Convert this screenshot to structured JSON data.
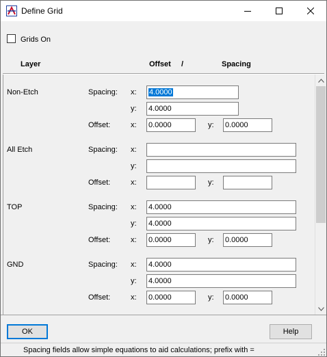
{
  "window": {
    "title": "Define Grid"
  },
  "grids_on": {
    "label": "Grids On",
    "checked": false
  },
  "headers": {
    "layer": "Layer",
    "offset": "Offset",
    "slash": "/",
    "spacing": "Spacing"
  },
  "labels": {
    "spacing": "Spacing:",
    "offset": "Offset:",
    "x": "x:",
    "y": "y:"
  },
  "layers": [
    {
      "name": "Non-Etch",
      "spacing_x": "4.0000",
      "spacing_y": "4.0000",
      "offset_x": "0.0000",
      "offset_y": "0.0000"
    },
    {
      "name": "All Etch",
      "spacing_x": "",
      "spacing_y": "",
      "offset_x": "",
      "offset_y": ""
    },
    {
      "name": "TOP",
      "spacing_x": "4.0000",
      "spacing_y": "4.0000",
      "offset_x": "0.0000",
      "offset_y": "0.0000"
    },
    {
      "name": "GND",
      "spacing_x": "4.0000",
      "spacing_y": "4.0000",
      "offset_x": "0.0000",
      "offset_y": "0.0000"
    }
  ],
  "buttons": {
    "ok": "OK",
    "help": "Help"
  },
  "status": "Spacing fields allow simple equations to aid calculations; prefix with =",
  "colors": {
    "selection": "#0078d7",
    "app_icon_red": "#c8102e",
    "app_icon_blue": "#1f3f9f"
  },
  "icons": {
    "app": "define-grid-app-icon",
    "minimize": "minimize-icon",
    "maximize": "maximize-icon",
    "close": "close-icon",
    "scroll_up": "scroll-up-arrow-icon",
    "scroll_down": "scroll-down-arrow-icon"
  }
}
